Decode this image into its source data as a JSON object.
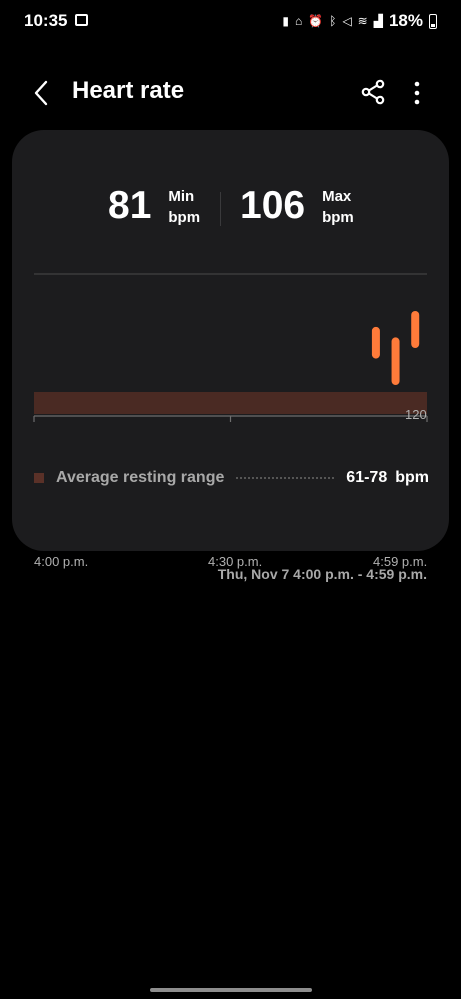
{
  "status_bar": {
    "time": "10:35",
    "battery_percent": "18%",
    "icons": [
      "image-icon",
      "battery-saver-icon",
      "sleep-icon",
      "alarm-icon",
      "bluetooth-icon",
      "mute-icon",
      "wifi-icon",
      "signal-icon",
      "battery-icon"
    ]
  },
  "header": {
    "title": "Heart rate",
    "back_icon": "back-chevron-icon",
    "share_icon": "share-icon",
    "more_icon": "more-vertical-icon"
  },
  "summary": {
    "min_value": "81",
    "min_label_line1": "Min",
    "min_label_line2": "bpm",
    "max_value": "106",
    "max_label_line1": "Max",
    "max_label_line2": "bpm"
  },
  "chart_data": {
    "type": "bar",
    "title": "",
    "y_max_label": "120",
    "ylim": [
      0,
      120
    ],
    "x_ticks": [
      "4:00 p.m.",
      "4:30 p.m.",
      "4:59 p.m."
    ],
    "resting_band": [
      61,
      78
    ],
    "series": [
      {
        "color": "#ff7b3a",
        "ranges": [
          {
            "x_fraction": 0.87,
            "low": 99,
            "high": 108
          },
          {
            "x_fraction": 0.92,
            "low": 89,
            "high": 104
          },
          {
            "x_fraction": 0.97,
            "low": 103,
            "high": 114
          }
        ]
      }
    ],
    "colors": {
      "bar": "#ff7b3a",
      "band": "#4a2a23",
      "axis": "#6e6e6e"
    }
  },
  "legend": {
    "label": "Average resting range",
    "range": "61-78",
    "unit": "bpm",
    "swatch_color": "#5a3128"
  },
  "date_range": "Thu, Nov 7 4:00 p.m. - 4:59 p.m."
}
